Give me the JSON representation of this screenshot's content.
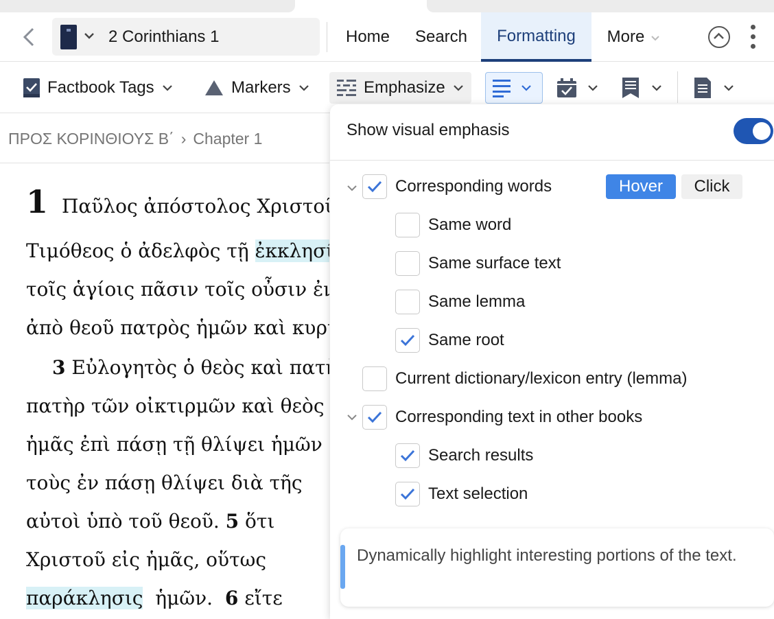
{
  "nav": {
    "book": "2 Corinthians 1",
    "items": [
      "Home",
      "Search",
      "Formatting",
      "More"
    ],
    "active": "Formatting"
  },
  "toolbar": {
    "factbook_tags": "Factbook Tags",
    "markers": "Markers",
    "emphasize": "Emphasize"
  },
  "breadcrumb": {
    "book": "ΠΡΟΣ ΚΟΡΙΝΘΙΟΥΣ Β΄",
    "separator": "›",
    "chapter": "Chapter 1"
  },
  "reader": {
    "chapter_number": "1",
    "lines": [
      "Παῦλος ἀπόστολος Χριστοῦ",
      "Τιμόθεος ὁ ἀδελφὸς τῇ",
      "ἐκκλησίᾳ",
      "τοῖς ἁγίοις πᾶσιν τοῖς οὖσιν ἐν",
      "ἀπὸ θεοῦ πατρὸς ἡμῶν καὶ κυρίου",
      "3",
      "Εὐλογητὸς ὁ θεὸς καὶ πατὴρ",
      "πατὴρ τῶν οἰκτιρμῶν καὶ θεὸς",
      "ἡμᾶς ἐπὶ πάσῃ τῇ θλίψει ἡμῶν",
      "τοὺς ἐν πάσῃ θλίψει διὰ τῆς",
      "αὐτοὶ ὑπὸ τοῦ θεοῦ.",
      "5",
      "ὅτι",
      "Χριστοῦ εἰς ἡμᾶς, οὕτως",
      "παράκλησις",
      "ἡμῶν.",
      "6",
      "εἴτε"
    ]
  },
  "emphasis_panel": {
    "show_label": "Show visual emphasis",
    "show_enabled": true,
    "corresponding_words": "Corresponding words",
    "hover": "Hover",
    "click": "Click",
    "same_word": "Same word",
    "same_surface_text": "Same surface text",
    "same_lemma": "Same lemma",
    "same_root": "Same root",
    "current_entry": "Current dictionary/lexicon entry (lemma)",
    "corresponding_text": "Corresponding text in other books",
    "search_results": "Search results",
    "text_selection": "Text selection",
    "tip": "Dynamically highlight interesting portions of the text."
  },
  "colors": {
    "accent": "#1f56b3",
    "segment_on": "#3f85e6",
    "highlight": "#d8f1f6",
    "check": "#3b74d8"
  }
}
